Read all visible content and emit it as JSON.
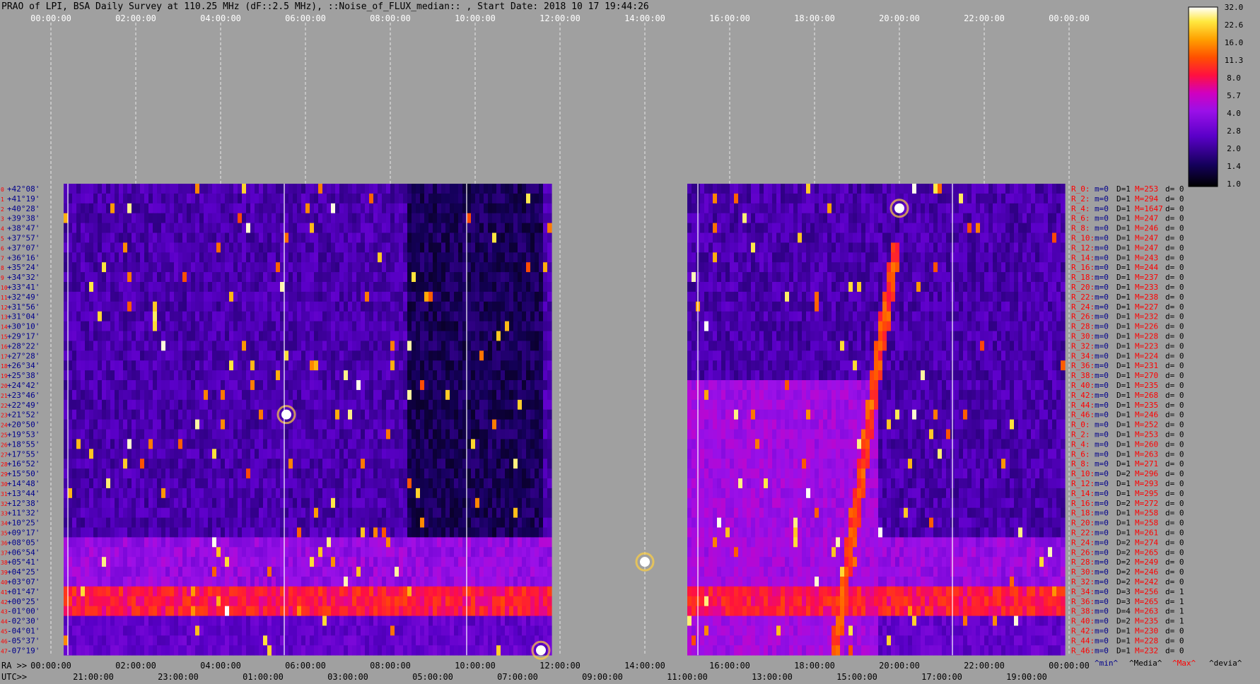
{
  "chart_data": {
    "type": "heatmap",
    "title": "PRAO of LPI, BSA Daily Survey at 110.25 MHz (dF::2.5 MHz), ::Noise_of_FLUX_median:: , Start Date: 2018 10 17 19:44:26",
    "top_axis_ticks": [
      "00:00:00",
      "02:00:00",
      "04:00:00",
      "06:00:00",
      "08:00:00",
      "10:00:00",
      "12:00:00",
      "14:00:00",
      "16:00:00",
      "18:00:00",
      "20:00:00",
      "22:00:00",
      "00:00:00"
    ],
    "ra_axis_label": "RA >>",
    "ra_ticks": [
      "00:00:00",
      "02:00:00",
      "04:00:00",
      "06:00:00",
      "08:00:00",
      "10:00:00",
      "12:00:00",
      "14:00:00",
      "16:00:00",
      "18:00:00",
      "20:00:00",
      "22:00:00",
      "00:00:00"
    ],
    "utc_axis_label": "UTC>>",
    "utc_ticks": [
      "21:00:00",
      "23:00:00",
      "01:00:00",
      "03:00:00",
      "05:00:00",
      "07:00:00",
      "09:00:00",
      "11:00:00",
      "13:00:00",
      "15:00:00",
      "17:00:00",
      "19:00:00"
    ],
    "colorbar": {
      "ticks": [
        "32.0",
        "22.6",
        "16.0",
        "11.3",
        "8.0",
        "5.7",
        "4.0",
        "2.8",
        "2.0",
        "1.4",
        "1.0"
      ],
      "range": [
        1.0,
        32.0
      ],
      "scale": "log"
    },
    "data_gap_ra_hours": [
      11.75,
      15.0
    ],
    "declinations": [
      "+42°08'",
      "+41°19'",
      "+40°28'",
      "+39°38'",
      "+38°47'",
      "+37°57'",
      "+37°07'",
      "+36°16'",
      "+35°24'",
      "+34°32'",
      "+33°41'",
      "+32°49'",
      "+31°56'",
      "+31°04'",
      "+30°10'",
      "+29°17'",
      "+28°22'",
      "+27°28'",
      "+26°34'",
      "+25°38'",
      "+24°42'",
      "+23°46'",
      "+22°49'",
      "+21°52'",
      "+20°50'",
      "+19°53'",
      "+18°55'",
      "+17°55'",
      "+16°52'",
      "+15°50'",
      "+14°48'",
      "+13°44'",
      "+12°38'",
      "+11°32'",
      "+10°25'",
      "+09°17'",
      "+08°05'",
      "+06°54'",
      "+05°41'",
      "+04°25'",
      "+03°07'",
      "+01°47'",
      "+00°25'",
      "-01°00'",
      "-02°30'",
      "-04°01'",
      "-05°37'",
      "-07°19'"
    ],
    "row_numbers": [
      "0",
      "1",
      "2",
      "3",
      "4",
      "5",
      "6",
      "7",
      "8",
      "9",
      "10",
      "11",
      "12",
      "13",
      "14",
      "15",
      "16",
      "17",
      "18",
      "19",
      "20",
      "21",
      "22",
      "23",
      "24",
      "25",
      "26",
      "27",
      "28",
      "29",
      "30",
      "31",
      "32",
      "33",
      "34",
      "35",
      "36",
      "37",
      "38",
      "39",
      "40",
      "41",
      "42",
      "43",
      "44",
      "45",
      "46",
      "47"
    ],
    "row_stats": [
      {
        "r": "R_0:",
        "m": "m=0",
        "D": "D=1",
        "M": "M=253",
        "d": "d= 0"
      },
      {
        "r": "R_2:",
        "m": "m=0",
        "D": "D=1",
        "M": "M=294",
        "d": "d= 0"
      },
      {
        "r": "R_4:",
        "m": "m=0",
        "D": "D=1",
        "M": "M=1647",
        "d": "d= 0"
      },
      {
        "r": "R_6:",
        "m": "m=0",
        "D": "D=1",
        "M": "M=247",
        "d": "d= 0"
      },
      {
        "r": "R_8:",
        "m": "m=0",
        "D": "D=1",
        "M": "M=246",
        "d": "d= 0"
      },
      {
        "r": "R_10:",
        "m": "m=0",
        "D": "D=1",
        "M": "M=247",
        "d": "d= 0"
      },
      {
        "r": "R_12:",
        "m": "m=0",
        "D": "D=1",
        "M": "M=247",
        "d": "d= 0"
      },
      {
        "r": "R_14:",
        "m": "m=0",
        "D": "D=1",
        "M": "M=243",
        "d": "d= 0"
      },
      {
        "r": "R_16:",
        "m": "m=0",
        "D": "D=1",
        "M": "M=244",
        "d": "d= 0"
      },
      {
        "r": "R_18:",
        "m": "m=0",
        "D": "D=1",
        "M": "M=237",
        "d": "d= 0"
      },
      {
        "r": "R_20:",
        "m": "m=0",
        "D": "D=1",
        "M": "M=233",
        "d": "d= 0"
      },
      {
        "r": "R_22:",
        "m": "m=0",
        "D": "D=1",
        "M": "M=238",
        "d": "d= 0"
      },
      {
        "r": "R_24:",
        "m": "m=0",
        "D": "D=1",
        "M": "M=227",
        "d": "d= 0"
      },
      {
        "r": "R_26:",
        "m": "m=0",
        "D": "D=1",
        "M": "M=232",
        "d": "d= 0"
      },
      {
        "r": "R_28:",
        "m": "m=0",
        "D": "D=1",
        "M": "M=226",
        "d": "d= 0"
      },
      {
        "r": "R_30:",
        "m": "m=0",
        "D": "D=1",
        "M": "M=228",
        "d": "d= 0"
      },
      {
        "r": "R_32:",
        "m": "m=0",
        "D": "D=1",
        "M": "M=223",
        "d": "d= 0"
      },
      {
        "r": "R_34:",
        "m": "m=0",
        "D": "D=1",
        "M": "M=224",
        "d": "d= 0"
      },
      {
        "r": "R_36:",
        "m": "m=0",
        "D": "D=1",
        "M": "M=231",
        "d": "d= 0"
      },
      {
        "r": "R_38:",
        "m": "m=0",
        "D": "D=1",
        "M": "M=270",
        "d": "d= 0"
      },
      {
        "r": "R_40:",
        "m": "m=0",
        "D": "D=1",
        "M": "M=235",
        "d": "d= 0"
      },
      {
        "r": "R_42:",
        "m": "m=0",
        "D": "D=1",
        "M": "M=268",
        "d": "d= 0"
      },
      {
        "r": "R_44:",
        "m": "m=0",
        "D": "D=1",
        "M": "M=235",
        "d": "d= 0"
      },
      {
        "r": "R_46:",
        "m": "m=0",
        "D": "D=1",
        "M": "M=246",
        "d": "d= 0"
      },
      {
        "r": "R_0:",
        "m": "m=0",
        "D": "D=1",
        "M": "M=252",
        "d": "d= 0"
      },
      {
        "r": "R_2:",
        "m": "m=0",
        "D": "D=1",
        "M": "M=253",
        "d": "d= 0"
      },
      {
        "r": "R_4:",
        "m": "m=0",
        "D": "D=1",
        "M": "M=260",
        "d": "d= 0"
      },
      {
        "r": "R_6:",
        "m": "m=0",
        "D": "D=1",
        "M": "M=263",
        "d": "d= 0"
      },
      {
        "r": "R_8:",
        "m": "m=0",
        "D": "D=1",
        "M": "M=271",
        "d": "d= 0"
      },
      {
        "r": "R_10:",
        "m": "m=0",
        "D": "D=2",
        "M": "M=296",
        "d": "d= 0"
      },
      {
        "r": "R_12:",
        "m": "m=0",
        "D": "D=1",
        "M": "M=293",
        "d": "d= 0"
      },
      {
        "r": "R_14:",
        "m": "m=0",
        "D": "D=1",
        "M": "M=295",
        "d": "d= 0"
      },
      {
        "r": "R_16:",
        "m": "m=0",
        "D": "D=2",
        "M": "M=272",
        "d": "d= 0"
      },
      {
        "r": "R_18:",
        "m": "m=0",
        "D": "D=1",
        "M": "M=258",
        "d": "d= 0"
      },
      {
        "r": "R_20:",
        "m": "m=0",
        "D": "D=1",
        "M": "M=258",
        "d": "d= 0"
      },
      {
        "r": "R_22:",
        "m": "m=0",
        "D": "D=1",
        "M": "M=261",
        "d": "d= 0"
      },
      {
        "r": "R_24:",
        "m": "m=0",
        "D": "D=2",
        "M": "M=274",
        "d": "d= 0"
      },
      {
        "r": "R_26:",
        "m": "m=0",
        "D": "D=2",
        "M": "M=265",
        "d": "d= 0"
      },
      {
        "r": "R_28:",
        "m": "m=0",
        "D": "D=2",
        "M": "M=249",
        "d": "d= 0"
      },
      {
        "r": "R_30:",
        "m": "m=0",
        "D": "D=2",
        "M": "M=246",
        "d": "d= 0"
      },
      {
        "r": "R_32:",
        "m": "m=0",
        "D": "D=2",
        "M": "M=242",
        "d": "d= 0"
      },
      {
        "r": "R_34:",
        "m": "m=0",
        "D": "D=3",
        "M": "M=256",
        "d": "d= 1"
      },
      {
        "r": "R_36:",
        "m": "m=0",
        "D": "D=3",
        "M": "M=265",
        "d": "d= 1"
      },
      {
        "r": "R_38:",
        "m": "m=0",
        "D": "D=4",
        "M": "M=263",
        "d": "d= 1"
      },
      {
        "r": "R_40:",
        "m": "m=0",
        "D": "D=2",
        "M": "M=235",
        "d": "d= 1"
      },
      {
        "r": "R_42:",
        "m": "m=0",
        "D": "D=1",
        "M": "M=230",
        "d": "d= 0"
      },
      {
        "r": "R_44:",
        "m": "m=0",
        "D": "D=1",
        "M": "M=228",
        "d": "d= 0"
      },
      {
        "r": "R_46:",
        "m": "m=0",
        "D": "D=1",
        "M": "M=232",
        "d": "d= 0"
      }
    ],
    "stats_legend": [
      {
        "text": "^min^",
        "color": "#00008b"
      },
      {
        "text": "^Media^",
        "color": "#000000"
      },
      {
        "text": "^Max^",
        "color": "#ff0000"
      },
      {
        "text": "^devia^",
        "color": "#000000"
      }
    ],
    "bright_sources": [
      {
        "ra_hours": 20.0,
        "row": 2
      },
      {
        "ra_hours": 5.55,
        "row": 23
      },
      {
        "ra_hours": 14.0,
        "row": 38
      },
      {
        "ra_hours": 11.55,
        "row": 47
      }
    ],
    "colors": {
      "background": "#a0a0a0",
      "row_label": "#00008b",
      "row_number": "#ff0000",
      "stat_red": "#ff0000",
      "stat_blue": "#00008b"
    }
  }
}
